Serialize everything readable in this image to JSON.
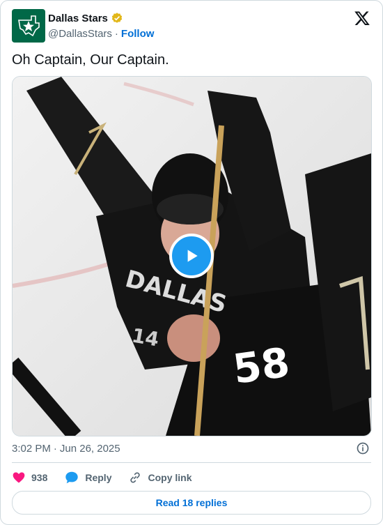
{
  "author": {
    "name": "Dallas Stars",
    "handle": "@DallasStars",
    "separator": "·",
    "follow_label": "Follow",
    "avatar_icon": "dallas-stars-logo",
    "verified_icon": "gold-verified-badge",
    "brand_color": "#006847"
  },
  "tweet": {
    "text": "Oh Captain, Our Captain.",
    "time": "3:02 PM",
    "separator": "·",
    "date": "Jun 26, 2025"
  },
  "media": {
    "type": "video",
    "play_icon": "play-icon"
  },
  "actions": {
    "likes": "938",
    "reply_label": "Reply",
    "copy_label": "Copy link"
  },
  "footer": {
    "read_replies_label": "Read 18 replies"
  },
  "colors": {
    "accent": "#1d9bf0",
    "link": "#006fd6",
    "like": "#f91880"
  }
}
